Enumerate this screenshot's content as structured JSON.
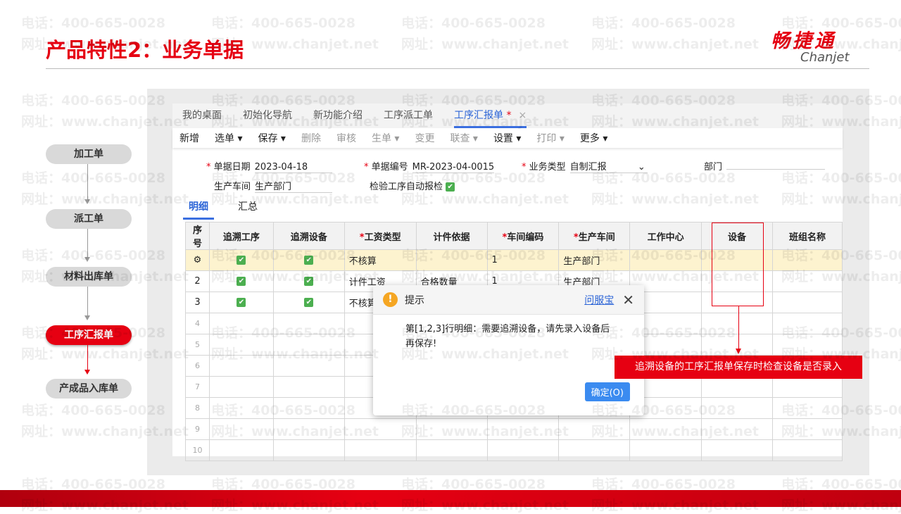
{
  "slide": {
    "title": "产品特性2：业务单据",
    "logo_cn": "畅捷通",
    "logo_en": "Chanjet",
    "watermark_phone": "电话：400-665-0028",
    "watermark_url": "网址：www.chanjet.net"
  },
  "flow": [
    "加工单",
    "派工单",
    "材料出库单",
    "工序汇报单",
    "产成品入库单"
  ],
  "tabs": [
    "我的桌面",
    "初始化导航",
    "新功能介绍",
    "工序派工单",
    "工序汇报单"
  ],
  "tab_star": "*",
  "tab_close": "×",
  "toolbar": [
    {
      "l": "新增",
      "d": false
    },
    {
      "l": "选单 ▾",
      "d": false
    },
    {
      "l": "保存 ▾",
      "d": false
    },
    {
      "l": "删除",
      "d": true
    },
    {
      "l": "审核",
      "d": true
    },
    {
      "l": "生单 ▾",
      "d": true
    },
    {
      "l": "变更",
      "d": true
    },
    {
      "l": "联查 ▾",
      "d": true
    },
    {
      "l": "设置 ▾",
      "d": false
    },
    {
      "l": "打印 ▾",
      "d": true
    },
    {
      "l": "更多 ▾",
      "d": false
    }
  ],
  "form": {
    "date_label": "单据日期",
    "date": "2023-04-18",
    "no_label": "单据编号",
    "no": "MR-2023-04-0015",
    "type_label": "业务类型",
    "type": "自制汇报",
    "dept_label": "部门",
    "ws_label": "生产车间",
    "ws": "生产部门",
    "auto_label": "检验工序自动报检"
  },
  "subtabs": [
    "明细",
    "汇总"
  ],
  "table": {
    "headers": [
      "序号",
      "追溯工序",
      "追溯设备",
      "工资类型",
      "计件依据",
      "车间编码",
      "生产车间",
      "工作中心",
      "设备",
      "班组名称"
    ],
    "rows": [
      [
        "⚙",
        "✔",
        "✔",
        "不核算",
        "",
        "1",
        "生产部门",
        "",
        "",
        ""
      ],
      [
        "2",
        "✔",
        "✔",
        "计件工资",
        "合格数量",
        "1",
        "生产部门",
        "",
        "",
        ""
      ],
      [
        "3",
        "✔",
        "✔",
        "不核算",
        "",
        "",
        "",
        "",
        "",
        ""
      ],
      [
        "4"
      ],
      [
        "5"
      ],
      [
        "6"
      ],
      [
        "7"
      ],
      [
        "8"
      ],
      [
        "9"
      ],
      [
        "10"
      ]
    ]
  },
  "dialog": {
    "title": "提示",
    "help": "问服宝",
    "message": "第[1,2,3]行明细：需要追溯设备，请先录入设备后再保存!",
    "ok": "确定(O)"
  },
  "callout": "追溯设备的工序汇报单保存时检查设备是否录入"
}
